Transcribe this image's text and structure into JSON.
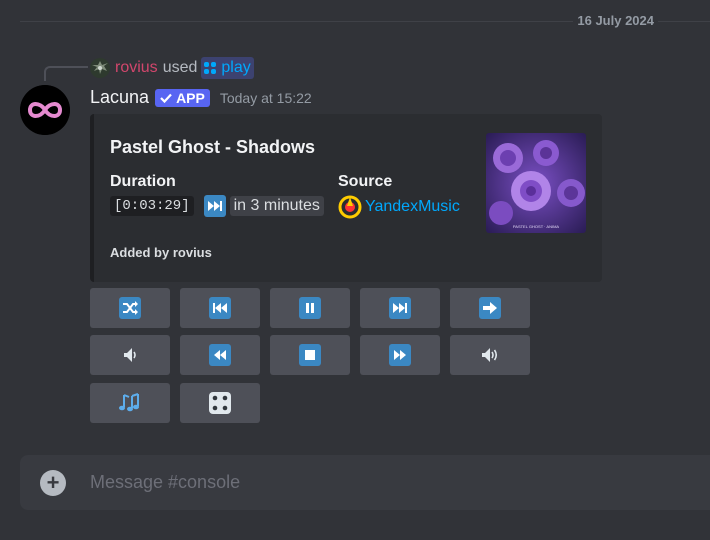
{
  "date_divider": "16 July 2024",
  "reply": {
    "user": "rovius",
    "used": "used",
    "command": "play"
  },
  "message": {
    "author": "Lacuna",
    "badge": "APP",
    "badge_color": "#5865f2",
    "timestamp": "Today at 15:22"
  },
  "embed": {
    "title": "Pastel Ghost - Shadows",
    "fields": [
      {
        "name": "Duration",
        "code": "[0:03:29]",
        "relative": "in 3 minutes"
      },
      {
        "name": "Source",
        "link": "YandexMusic"
      }
    ],
    "footer": "Added by rovius",
    "thumbnail_caption": "PASTEL GHOST · ANIMA"
  },
  "controls": {
    "rows": [
      [
        "shuffle-icon",
        "previous-track-icon",
        "pause-icon",
        "next-track-icon",
        "right-arrow-icon"
      ],
      [
        "volume-low-icon",
        "rewind-icon",
        "stop-icon",
        "fast-forward-icon",
        "volume-high-icon"
      ],
      [
        "music-notes-icon",
        "dice-icon"
      ]
    ]
  },
  "composer": {
    "placeholder": "Message #console"
  },
  "colors": {
    "background": "#313338",
    "embed_bg": "#2b2d31",
    "button_bg": "#4e5058",
    "emoji_blue": "#3b88c3",
    "link": "#00a8fc",
    "reply_user": "#d1466c"
  }
}
